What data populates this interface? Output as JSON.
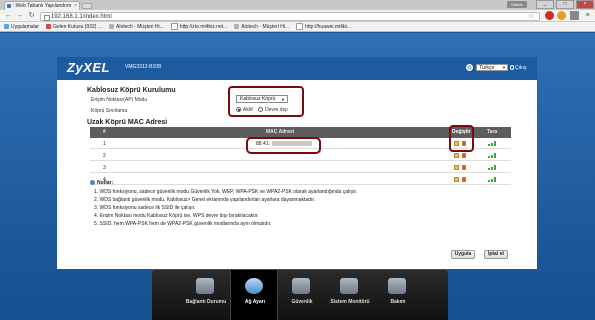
{
  "browser": {
    "tab_title": "::Web Tabanlı Yapılandırm",
    "user_badge": "Hatice",
    "window_buttons": [
      "_",
      "□",
      "×"
    ],
    "url": "192.168.1.1/index.html",
    "bookmarks": [
      {
        "label": "Uygulamalar",
        "icon": "apps-icon"
      },
      {
        "label": "Gelen Kutusu (932) ...",
        "icon": "gmail-icon"
      },
      {
        "label": "Alotech - Müşteri Hi...",
        "icon": "page-icon"
      },
      {
        "label": "http://zte.mi4biz.net...",
        "icon": "page-icon"
      },
      {
        "label": "Alotech - Müşteri Hi...",
        "icon": "page-icon"
      },
      {
        "label": "http://huawei.mi4bi...",
        "icon": "page-icon"
      }
    ]
  },
  "header": {
    "brand": "ZyXEL",
    "model": "VMG3312-B10B",
    "language": "Türkçe",
    "logout": "Çıkış"
  },
  "bridge": {
    "title": "Kablosuz Köprü Kurulumu",
    "ap_mode_label": "Erişim Noktası(AP) Modu",
    "ap_mode_value": "Kablosuz Köprü",
    "limit_label": "Köprü Sınırlama",
    "radio_on": "Aktif",
    "radio_off": "Devre dışı",
    "radio_selected": "Aktif"
  },
  "remote": {
    "title": "Uzak Köprü MAC Adresi",
    "columns": [
      "#",
      "MAC Adresi",
      "Değiştir",
      "Tara"
    ],
    "rows": [
      {
        "num": "1",
        "mac": "88:41:"
      },
      {
        "num": "2",
        "mac": ""
      },
      {
        "num": "3",
        "mac": ""
      },
      {
        "num": "4",
        "mac": ""
      }
    ]
  },
  "notes": {
    "title": "Notlar:",
    "items": [
      "1. WDS fonksiyonu, sadece güvenlik modu Güvenlik Yok, WEP, WPA-PSK ve WPA2-PSK olarak ayarlandığında çalışır.",
      "2. WDS bağlantı güvenlik modu, Kablosuz> Genel ekranında yapılandırılan ayarlara dayanmaktadır.",
      "3. WDS fonksiyonu sadece ilk SSID ile çalışır.",
      "4. Erişim Noktası modu Kablosuz Köprü ise, WPS devre dışı bırakılacaktır.",
      "5. SSID, hem WPA-PSK hem de WPA2-PSK güvenlik modlarında aynı olmalıdır."
    ]
  },
  "buttons": {
    "apply": "Uygula",
    "cancel": "İptal et"
  },
  "bottom_nav": [
    {
      "label": "Bağlantı Durumu",
      "icon": "connection-status-icon"
    },
    {
      "label": "Ağ Ayarı",
      "icon": "network-settings-icon",
      "active": true
    },
    {
      "label": "Güvenlik",
      "icon": "security-shield-icon"
    },
    {
      "label": "Sistem Monitörü",
      "icon": "system-monitor-icon"
    },
    {
      "label": "Bakım",
      "icon": "maintenance-icon"
    }
  ],
  "colors": {
    "accent_red": "#7a0a12",
    "page_blue": "#1e5b9e",
    "signal_green": "#2fae3a"
  }
}
